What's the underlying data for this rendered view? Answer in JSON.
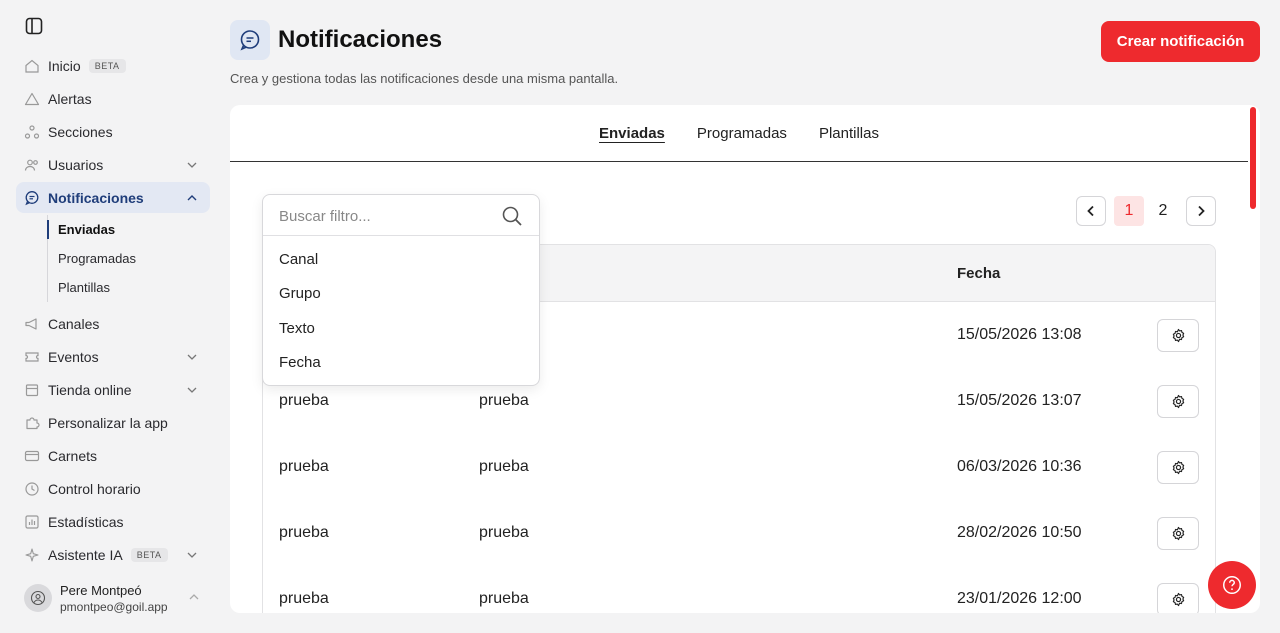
{
  "sidebar": {
    "items": [
      {
        "label": "Inicio",
        "badge": "BETA",
        "icon": "home-icon"
      },
      {
        "label": "Alertas",
        "icon": "alert-triangle-icon"
      },
      {
        "label": "Secciones",
        "icon": "sections-icon"
      },
      {
        "label": "Usuarios",
        "icon": "users-icon"
      },
      {
        "label": "Notificaciones",
        "icon": "chat-bubble-icon"
      },
      {
        "label": "Canales",
        "icon": "megaphone-icon"
      },
      {
        "label": "Eventos",
        "icon": "ticket-icon"
      },
      {
        "label": "Tienda online",
        "icon": "store-icon"
      },
      {
        "label": "Personalizar la app",
        "icon": "puzzle-icon"
      },
      {
        "label": "Carnets",
        "icon": "card-icon"
      },
      {
        "label": "Control horario",
        "icon": "clock-icon"
      },
      {
        "label": "Estadísticas",
        "icon": "chart-icon"
      },
      {
        "label": "Asistente IA",
        "badge": "BETA",
        "icon": "sparkle-icon"
      }
    ],
    "subitems": [
      "Enviadas",
      "Programadas",
      "Plantillas"
    ],
    "user": {
      "name": "Pere Montpeó",
      "email": "pmontpeo@goil.app"
    }
  },
  "header": {
    "title": "Notificaciones",
    "subtitle": "Crea y gestiona todas las notificaciones desde una misma pantalla.",
    "create_label": "Crear notificación"
  },
  "tabs": [
    "Enviadas",
    "Programadas",
    "Plantillas"
  ],
  "filter": {
    "placeholder": "Buscar filtro...",
    "options": [
      "Canal",
      "Grupo",
      "Texto",
      "Fecha"
    ]
  },
  "pagination": {
    "pages": [
      "1",
      "2"
    ],
    "current": "1"
  },
  "table": {
    "date_header": "Fecha",
    "rows": [
      {
        "c1": "",
        "c2": "",
        "date": "15/05/2026 13:08"
      },
      {
        "c1": "prueba",
        "c2": "prueba",
        "date": "15/05/2026 13:07"
      },
      {
        "c1": "prueba",
        "c2": "prueba",
        "date": "06/03/2026 10:36"
      },
      {
        "c1": "prueba",
        "c2": "prueba",
        "date": "28/02/2026 10:50"
      },
      {
        "c1": "prueba",
        "c2": "prueba",
        "date": "23/01/2026 12:00"
      }
    ]
  },
  "colors": {
    "accent": "#ee2a2e",
    "active_nav_bg": "#e3e8f3",
    "active_nav_text": "#1f3d7a"
  }
}
